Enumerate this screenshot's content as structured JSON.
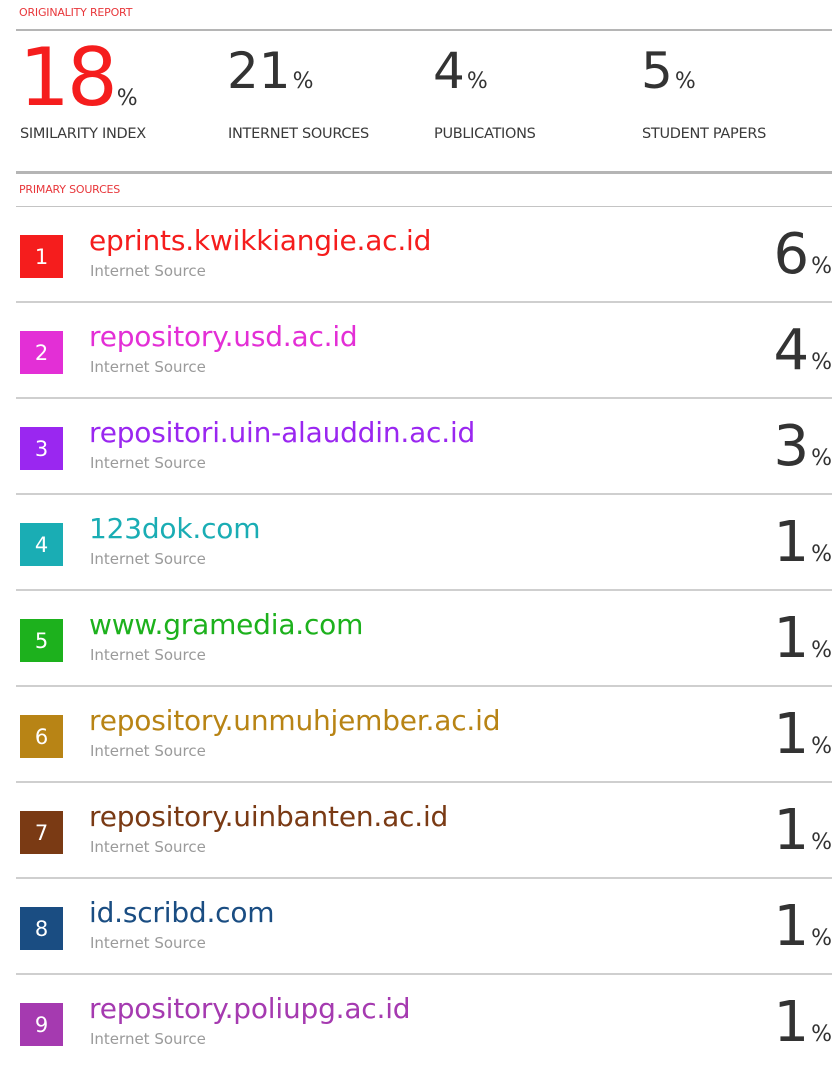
{
  "header": {
    "title": "ORIGINALITY REPORT"
  },
  "stats": [
    {
      "value": "18",
      "unit": "%",
      "label": "SIMILARITY INDEX"
    },
    {
      "value": "21",
      "unit": "%",
      "label": "INTERNET SOURCES"
    },
    {
      "value": "4",
      "unit": "%",
      "label": "PUBLICATIONS"
    },
    {
      "value": "5",
      "unit": "%",
      "label": "STUDENT PAPERS"
    }
  ],
  "primary": {
    "title": "PRIMARY SOURCES",
    "sources": [
      {
        "rank": "1",
        "name": "eprints.kwikkiangie.ac.id",
        "type": "Internet Source",
        "value": "6",
        "unit": "%",
        "color": "#f51d1d"
      },
      {
        "rank": "2",
        "name": "repository.usd.ac.id",
        "type": "Internet Source",
        "value": "4",
        "unit": "%",
        "color": "#e32fd6"
      },
      {
        "rank": "3",
        "name": "repositori.uin-alauddin.ac.id",
        "type": "Internet Source",
        "value": "3",
        "unit": "%",
        "color": "#9a27f0"
      },
      {
        "rank": "4",
        "name": "123dok.com",
        "type": "Internet Source",
        "value": "1",
        "unit": "%",
        "color": "#1aadb4"
      },
      {
        "rank": "5",
        "name": "www.gramedia.com",
        "type": "Internet Source",
        "value": "1",
        "unit": "%",
        "color": "#1db11d"
      },
      {
        "rank": "6",
        "name": "repository.unmuhjember.ac.id",
        "type": "Internet Source",
        "value": "1",
        "unit": "%",
        "color": "#b88415"
      },
      {
        "rank": "7",
        "name": "repository.uinbanten.ac.id",
        "type": "Internet Source",
        "value": "1",
        "unit": "%",
        "color": "#7a3a14"
      },
      {
        "rank": "8",
        "name": "id.scribd.com",
        "type": "Internet Source",
        "value": "1",
        "unit": "%",
        "color": "#1a4d82"
      },
      {
        "rank": "9",
        "name": "repository.poliupg.ac.id",
        "type": "Internet Source",
        "value": "1",
        "unit": "%",
        "color": "#a53ab0"
      }
    ]
  }
}
